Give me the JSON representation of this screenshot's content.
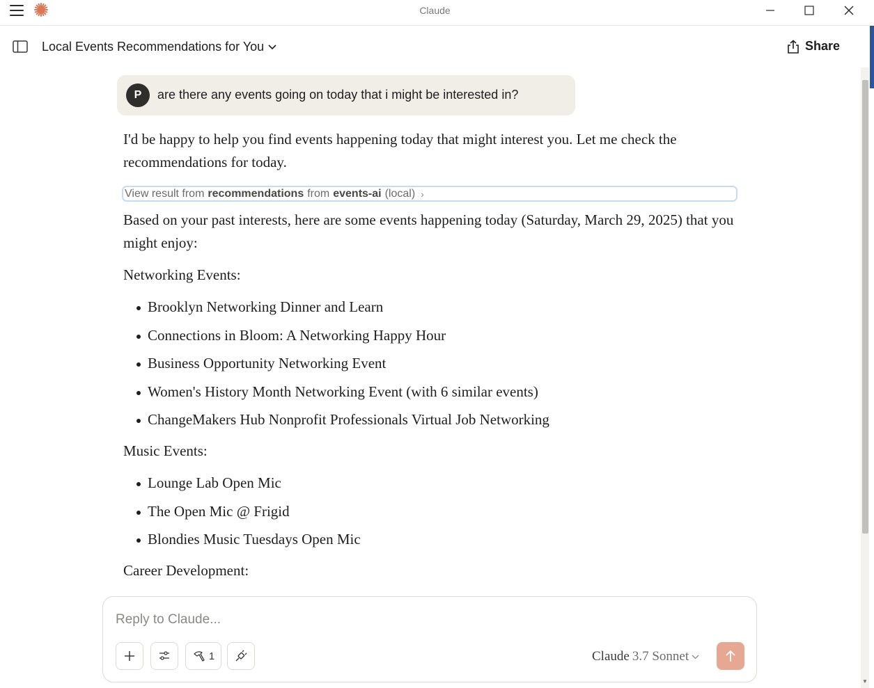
{
  "window": {
    "title": "Claude"
  },
  "header": {
    "chat_title": "Local Events Recommendations for You",
    "share_label": "Share"
  },
  "user_message": {
    "avatar_initial": "P",
    "text": "are there any events going on today that i might be interested in?"
  },
  "assistant": {
    "intro": "I'd be happy to help you find events happening today that might interest you. Let me check the recommendations for today.",
    "tool_result": {
      "prefix": "View result from",
      "tool": "recommendations",
      "mid": "from",
      "server": "events-ai",
      "suffix": "(local)"
    },
    "summary": "Based on your past interests, here are some events happening today (Saturday, March 29, 2025) that you might enjoy:",
    "sections": [
      {
        "heading": "Networking Events:",
        "items": [
          "Brooklyn Networking Dinner and Learn",
          "Connections in Bloom: A Networking Happy Hour",
          "Business Opportunity Networking Event",
          "Women's History Month Networking Event (with 6 similar events)",
          "ChangeMakers Hub Nonprofit Professionals Virtual Job Networking"
        ]
      },
      {
        "heading": "Music Events:",
        "items": [
          "Lounge Lab Open Mic",
          "The Open Mic @ Frigid",
          "Blondies Music Tuesdays Open Mic"
        ]
      },
      {
        "heading": "Career Development:",
        "items": []
      }
    ]
  },
  "composer": {
    "placeholder": "Reply to Claude...",
    "tools_count": "1",
    "model_name": "Claude",
    "model_version": "3.7 Sonnet"
  },
  "colors": {
    "accent": "#d97757",
    "send_button": "#e6a892",
    "user_bubble": "#f0eee7"
  }
}
